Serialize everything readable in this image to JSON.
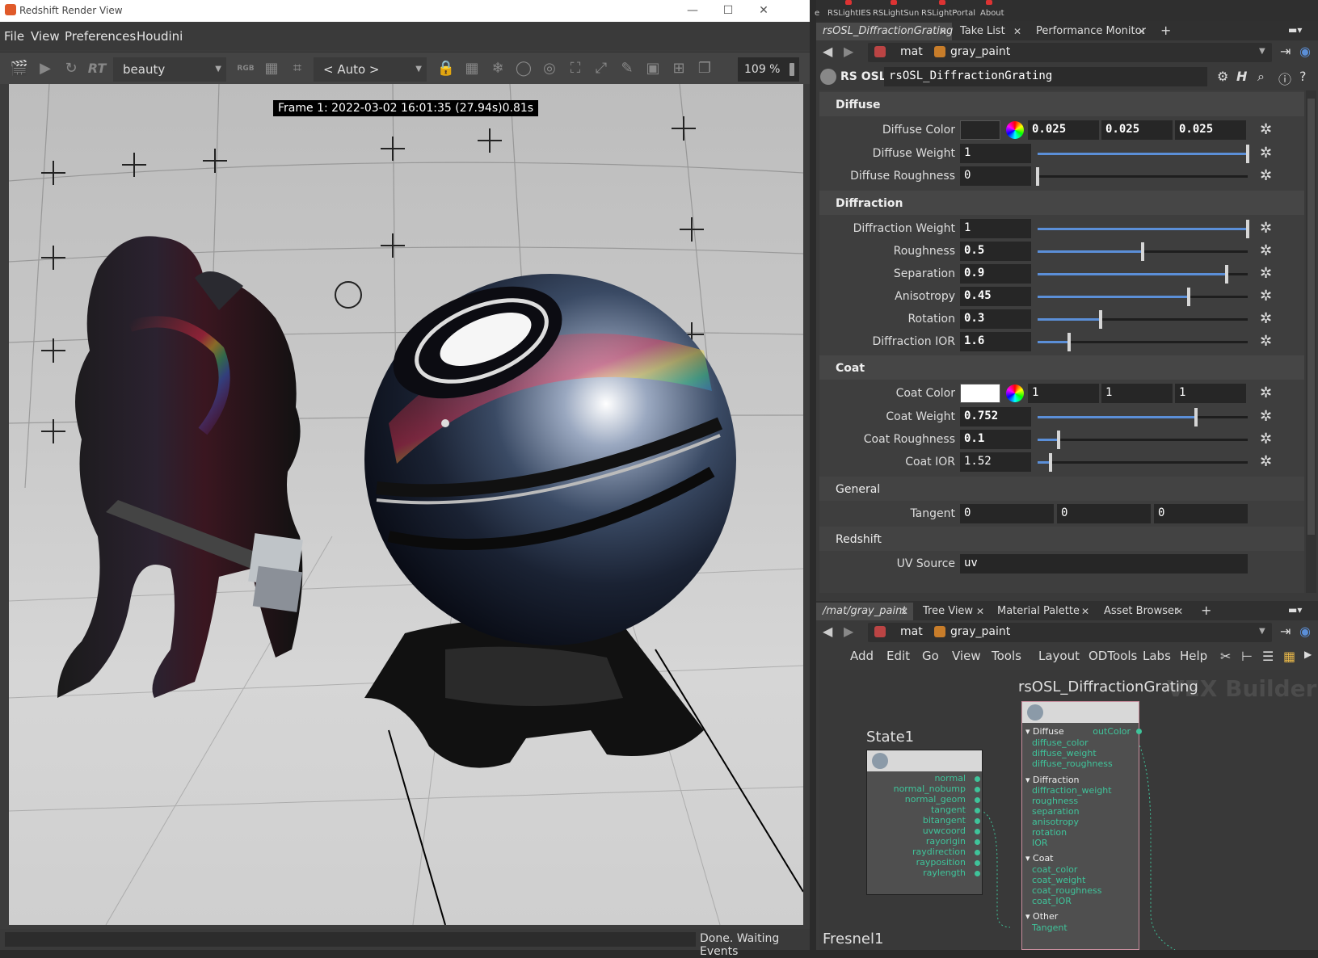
{
  "render_view": {
    "title": "Redshift Render View",
    "menu": [
      "File",
      "View",
      "Preferences",
      "Houdini"
    ],
    "toolbar": {
      "rt_label": "RT",
      "aov": "beauty",
      "rgb_label": "RGB",
      "camera": "< Auto >",
      "zoom": "109 %"
    },
    "frame_label": "Frame  1: 2022-03-02  16:01:35  (27.94s)0.81s",
    "status": "Done. Waiting Events",
    "window_buttons": [
      "—",
      "☐",
      "✕"
    ]
  },
  "shelf": [
    "e",
    "RSLightIES",
    "RSLightSun",
    "RSLightPortal",
    "About"
  ],
  "top_tabs": [
    {
      "label": "rsOSL_DiffractionGrating",
      "active": true
    },
    {
      "label": "Take List"
    },
    {
      "label": "Performance Monitor"
    }
  ],
  "path": {
    "context": "mat",
    "node": "gray_paint"
  },
  "osl": {
    "label": "RS OSL",
    "name": "rsOSL_DiffractionGrating"
  },
  "params": {
    "diffuse": {
      "title": "Diffuse",
      "color_label": "Diffuse Color",
      "color": [
        "0.025",
        "0.025",
        "0.025"
      ],
      "color_swatch": "#262626",
      "weight_label": "Diffuse Weight",
      "weight": "1",
      "weight_frac": 1.0,
      "roughness_label": "Diffuse Roughness",
      "roughness": "0",
      "roughness_frac": 0.0
    },
    "diffraction": {
      "title": "Diffraction",
      "weight_label": "Diffraction Weight",
      "weight": "1",
      "weight_frac": 1.0,
      "roughness_label": "Roughness",
      "roughness": "0.5",
      "roughness_frac": 0.5,
      "separation_label": "Separation",
      "separation": "0.9",
      "separation_frac": 0.9,
      "anisotropy_label": "Anisotropy",
      "anisotropy": "0.45",
      "anisotropy_frac": 0.72,
      "rotation_label": "Rotation",
      "rotation": "0.3",
      "rotation_frac": 0.3,
      "ior_label": "Diffraction IOR",
      "ior": "1.6",
      "ior_frac": 0.15
    },
    "coat": {
      "title": "Coat",
      "color_label": "Coat Color",
      "color": [
        "1",
        "1",
        "1"
      ],
      "color_swatch": "#ffffff",
      "weight_label": "Coat Weight",
      "weight": "0.752",
      "weight_frac": 0.752,
      "roughness_label": "Coat Roughness",
      "roughness": "0.1",
      "roughness_frac": 0.1,
      "ior_label": "Coat IOR",
      "ior": "1.52",
      "ior_frac": 0.06
    },
    "general": {
      "title": "General",
      "tangent_label": "Tangent",
      "tangent": [
        "0",
        "0",
        "0"
      ]
    },
    "redshift": {
      "title": "Redshift",
      "uv_label": "UV Source",
      "uv": "uv"
    }
  },
  "bottom_tabs": [
    {
      "label": "/mat/gray_paint",
      "active": true
    },
    {
      "label": "Tree View"
    },
    {
      "label": "Material Palette"
    },
    {
      "label": "Asset Browser"
    }
  ],
  "network_menu": [
    "Add",
    "Edit",
    "Go",
    "View",
    "Tools",
    "Layout",
    "ODTools",
    "Labs",
    "Help"
  ],
  "network": {
    "watermark": "VEX Builder",
    "state_node": {
      "name": "State1",
      "outputs": [
        "normal",
        "normal_nobump",
        "normal_geom",
        "tangent",
        "bitangent",
        "uvwcoord",
        "rayorigin",
        "raydirection",
        "rayposition",
        "raylength"
      ]
    },
    "osl_node": {
      "name": "rsOSL_DiffractionGrating",
      "output": "outColor",
      "groups": [
        {
          "name": "Diffuse",
          "inputs": [
            "diffuse_color",
            "diffuse_weight",
            "diffuse_roughness"
          ]
        },
        {
          "name": "Diffraction",
          "inputs": [
            "diffraction_weight",
            "roughness",
            "separation",
            "anisotropy",
            "rotation",
            "IOR"
          ]
        },
        {
          "name": "Coat",
          "inputs": [
            "coat_color",
            "coat_weight",
            "coat_roughness",
            "coat_IOR"
          ]
        },
        {
          "name": "Other",
          "inputs": [
            "Tangent"
          ]
        }
      ]
    },
    "fresnel_node": {
      "name": "Fresnel1"
    }
  },
  "colors": {
    "accent": "#5b8fd8",
    "port": "#3fc39a",
    "panel": "#3a3a3a"
  }
}
